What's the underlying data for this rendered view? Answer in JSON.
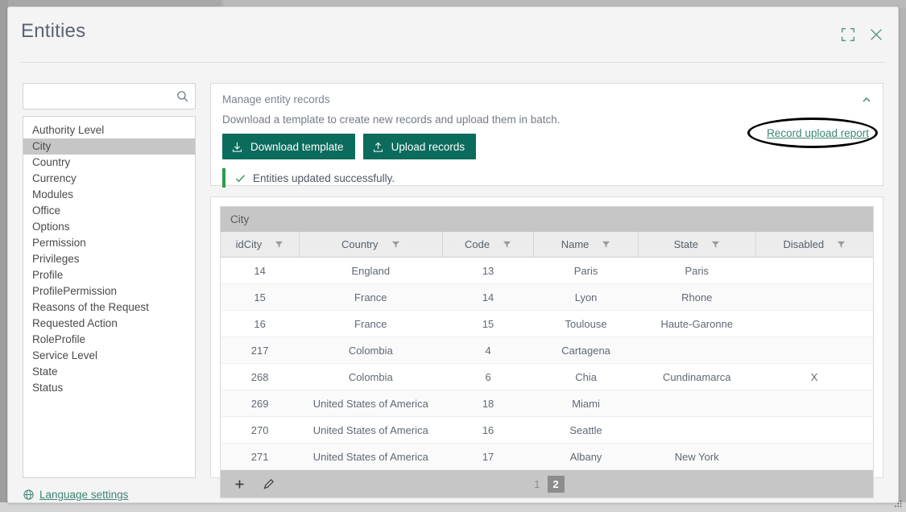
{
  "dialog": {
    "title": "Entities",
    "expand_icon": "expand-icon",
    "close_icon": "close-icon"
  },
  "sidebar": {
    "search": {
      "value": "",
      "placeholder": "",
      "icon": "search-icon"
    },
    "items": [
      {
        "label": "Authority Level",
        "selected": false
      },
      {
        "label": "City",
        "selected": true
      },
      {
        "label": "Country",
        "selected": false
      },
      {
        "label": "Currency",
        "selected": false
      },
      {
        "label": "Modules",
        "selected": false
      },
      {
        "label": "Office",
        "selected": false
      },
      {
        "label": "Options",
        "selected": false
      },
      {
        "label": "Permission",
        "selected": false
      },
      {
        "label": "Privileges",
        "selected": false
      },
      {
        "label": "Profile",
        "selected": false
      },
      {
        "label": "ProfilePermission",
        "selected": false
      },
      {
        "label": "Reasons of the Request",
        "selected": false
      },
      {
        "label": "Requested Action",
        "selected": false
      },
      {
        "label": "RoleProfile",
        "selected": false
      },
      {
        "label": "Service Level",
        "selected": false
      },
      {
        "label": "State",
        "selected": false
      },
      {
        "label": "Status",
        "selected": false
      }
    ],
    "language_link": "Language settings",
    "language_icon": "globe-icon"
  },
  "manage_panel": {
    "title": "Manage entity records",
    "subtitle": "Download a template to create new records and upload them in batch.",
    "download_button": "Download template",
    "download_icon": "download-icon",
    "upload_button": "Upload records",
    "upload_icon": "upload-icon",
    "collapse_icon": "chevron-up-icon",
    "status_message": "Entities updated successfully.",
    "status_icon": "check-icon",
    "report_link": "Record upload report",
    "annotation": "ellipse-highlight",
    "button_color": "#0b6b5c",
    "accent_color": "#3f8474",
    "success_color": "#2e9b4e"
  },
  "grid": {
    "caption": "City",
    "columns": [
      {
        "label": "idCity",
        "filter_icon": "filter-icon",
        "width": "12%"
      },
      {
        "label": "Country",
        "filter_icon": "filter-icon",
        "width": "22%"
      },
      {
        "label": "Code",
        "filter_icon": "filter-icon",
        "width": "14%"
      },
      {
        "label": "Name",
        "filter_icon": "filter-icon",
        "width": "16%"
      },
      {
        "label": "State",
        "filter_icon": "filter-icon",
        "width": "18%"
      },
      {
        "label": "Disabled",
        "filter_icon": "filter-icon",
        "width": "18%"
      }
    ],
    "rows": [
      [
        "14",
        "England",
        "13",
        "Paris",
        "Paris",
        ""
      ],
      [
        "15",
        "France",
        "14",
        "Lyon",
        "Rhone",
        ""
      ],
      [
        "16",
        "France",
        "15",
        "Toulouse",
        "Haute-Garonne",
        ""
      ],
      [
        "217",
        "Colombia",
        "4",
        "Cartagena",
        "",
        ""
      ],
      [
        "268",
        "Colombia",
        "6",
        "Chia",
        "Cundinamarca",
        "X"
      ],
      [
        "269",
        "United States of America",
        "18",
        "Miami",
        "",
        ""
      ],
      [
        "270",
        "United States of America",
        "16",
        "Seattle",
        "",
        ""
      ],
      [
        "271",
        "United States of America",
        "17",
        "Albany",
        "New York",
        ""
      ]
    ],
    "footer": {
      "add_icon": "plus-icon",
      "edit_icon": "pencil-icon",
      "pages": [
        {
          "label": "1",
          "active": false
        },
        {
          "label": "2",
          "active": true
        }
      ]
    }
  }
}
